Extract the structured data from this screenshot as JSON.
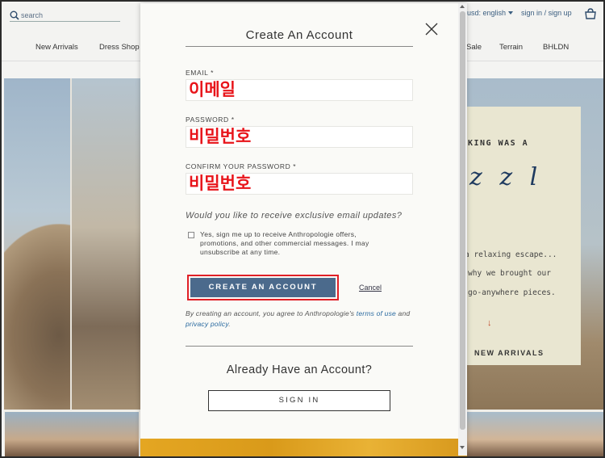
{
  "header": {
    "search_placeholder": "search",
    "currency": "usd: english",
    "sign_in": "sign in / sign up",
    "nav": [
      "New Arrivals",
      "Dress Shop",
      "Sale",
      "Terrain",
      "BHLDN"
    ]
  },
  "promo": {
    "line1": "KING WAS A",
    "script": "z z l",
    "line2": "a relaxing escape...",
    "line3": "why we brought our",
    "line4": "go-anywhere pieces.",
    "cta": "NEW ARRIVALS"
  },
  "modal": {
    "title": "Create An Account",
    "email_label": "EMAIL *",
    "email_value": "이메일",
    "password_label": "PASSWORD *",
    "password_value": "비밀번호",
    "confirm_label": "CONFIRM YOUR PASSWORD *",
    "confirm_value": "비밀번호",
    "optin_question": "Would you like to receive exclusive email updates?",
    "optin_text": "Yes, sign me up to receive Anthropologie offers, promotions, and other commercial messages. I may unsubscribe at any time.",
    "create_button": "CREATE AN ACCOUNT",
    "cancel": "Cancel",
    "terms_prefix": "By creating an account, you agree to Anthropologie's ",
    "terms_link": "terms of use",
    "terms_mid": " and ",
    "privacy_link": "privacy policy",
    "terms_suffix": ".",
    "already_heading": "Already Have an Account?",
    "signin_button": "SIGN IN"
  },
  "colors": {
    "accent": "#4b6a8c",
    "highlight_red": "#e01f26",
    "link": "#2a6aa0"
  }
}
